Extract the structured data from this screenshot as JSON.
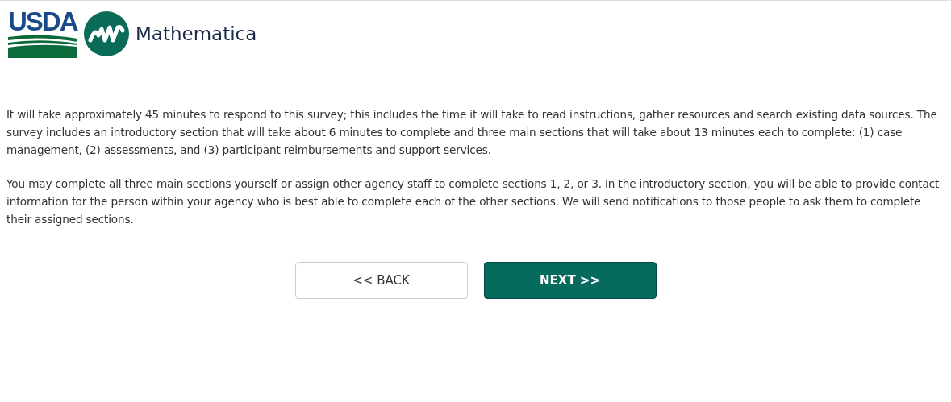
{
  "header": {
    "logos": [
      {
        "kind": "usda",
        "text": "USDA"
      },
      {
        "kind": "mathematica",
        "text": "Mathematica"
      }
    ]
  },
  "paragraphs": [
    "It will take approximately 45 minutes to respond to this survey; this includes the time it will take to read instructions, gather resources and search existing data sources. The survey includes an introductory section that will take about 6 minutes to complete and three main sections that will take about 13 minutes each to complete: (1) case management, (2) assessments, and (3) participant reimbursements and support services.",
    "You may complete all three main sections yourself or assign other agency staff to complete sections 1, 2, or 3. In the introductory section, you will be able to provide contact information for the person within your agency who is best able to complete each of the other sections. We will send notifications to those people to ask them to complete their assigned sections."
  ],
  "buttons": [
    {
      "kind": "secondary",
      "label": "<< BACK"
    },
    {
      "kind": "primary",
      "label": "NEXT >>"
    }
  ]
}
